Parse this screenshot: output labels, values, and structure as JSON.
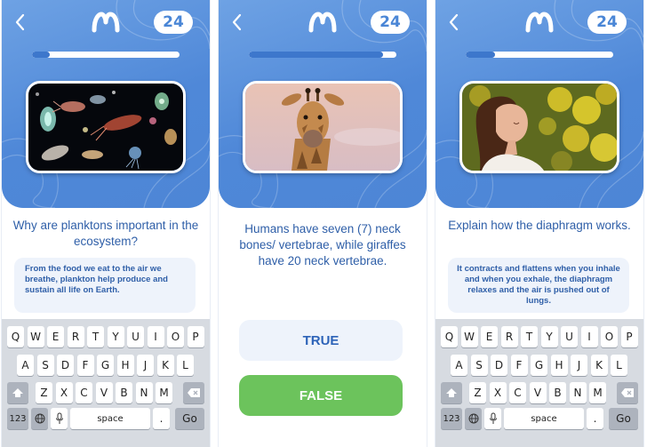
{
  "screens": [
    {
      "score": "24",
      "progress": 0.12,
      "image_subject": "plankton",
      "question": "Why are planktons important in the ecosystem?",
      "answer": "From the food we eat to the air we breathe, plankton help produce and sustain all life on Earth."
    },
    {
      "score": "24",
      "progress": 0.91,
      "image_subject": "giraffe",
      "question": "Humans have seven (7) neck bones/ vertebrae, while giraffes have 20 neck vertebrae.",
      "true_label": "TRUE",
      "false_label": "FALSE"
    },
    {
      "score": "24",
      "progress": 0.2,
      "image_subject": "woman-breathing",
      "question": "Explain how the diaphragm works.",
      "answer": "It contracts and flattens when you inhale and when you exhale, the diaphragm relaxes and the air is pushed out of lungs."
    }
  ],
  "keyboard": {
    "row1": [
      "Q",
      "W",
      "E",
      "R",
      "T",
      "Y",
      "U",
      "I",
      "O",
      "P"
    ],
    "row2": [
      "A",
      "S",
      "D",
      "F",
      "G",
      "H",
      "J",
      "K",
      "L"
    ],
    "row3": [
      "Z",
      "X",
      "C",
      "V",
      "B",
      "N",
      "M"
    ],
    "numbers_key": "123",
    "space_key": "space",
    "period_key": ".",
    "go_key": "Go"
  },
  "icons": {
    "back": "chevron-left-icon",
    "logo": "m-logo-icon",
    "shift": "shift-icon",
    "delete": "backspace-icon",
    "globe": "globe-icon",
    "mic": "mic-icon"
  },
  "colors": {
    "header_blue": "#4f88d8",
    "text_blue": "#2f5fa8",
    "answer_bg": "#eef3fb",
    "false_green": "#6cc35c"
  }
}
